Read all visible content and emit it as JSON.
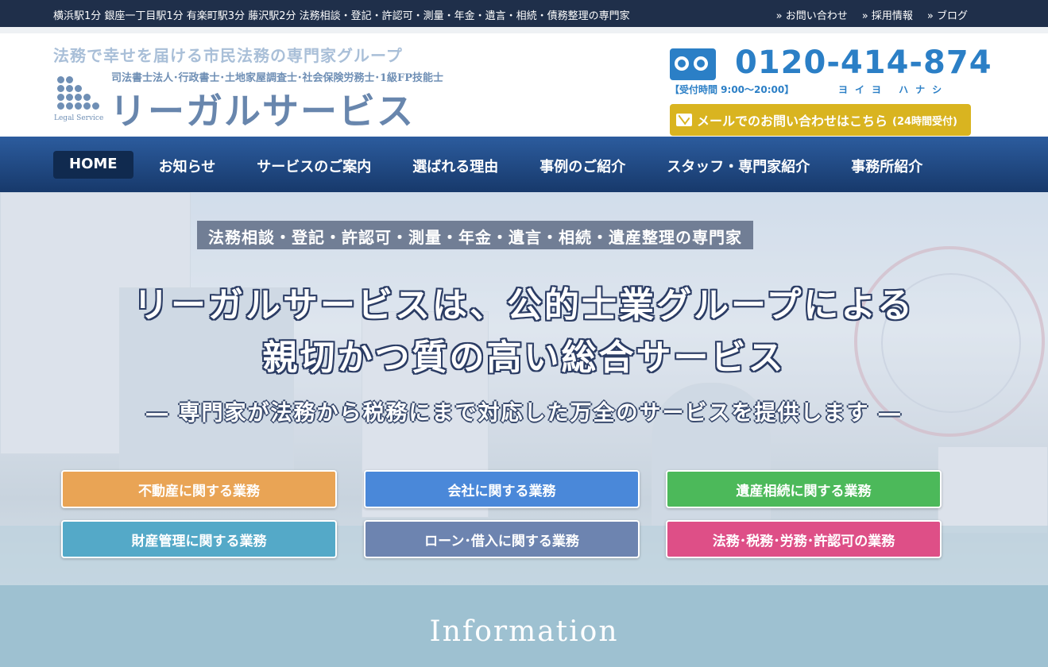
{
  "topbar": {
    "tagline": "横浜駅1分 銀座一丁目駅1分 有楽町駅3分 藤沢駅2分 法務相談・登記・許認可・測量・年金・遺言・相続・債務整理の専門家",
    "links": [
      {
        "label": "お問い合わせ"
      },
      {
        "label": "採用情報"
      },
      {
        "label": "ブログ"
      }
    ]
  },
  "header": {
    "slogan": "法務で幸せを届ける市民法務の専門家グループ",
    "subtitle": "司法書士法人･行政書士･土地家屋調査士･社会保険労務士･1級FP技能士",
    "brand_name": "リーガルサービス",
    "logo_caption": "Legal Service",
    "phone": {
      "number": "0120-414-874",
      "hours": "【受付時間 9:00～20:00】",
      "reading": "ヨイヨ ハナシ"
    },
    "mail_button": {
      "label": "メールでのお問い合わせはこちら",
      "note": "(24時間受付)"
    }
  },
  "nav": {
    "items": [
      {
        "label": "HOME",
        "active": true
      },
      {
        "label": "お知らせ"
      },
      {
        "label": "サービスのご案内"
      },
      {
        "label": "選ばれる理由"
      },
      {
        "label": "事例のご紹介"
      },
      {
        "label": "スタッフ・専門家紹介"
      },
      {
        "label": "事務所紹介"
      }
    ]
  },
  "hero": {
    "badge": "法務相談・登記・許認可・測量・年金・遺言・相続・遺産整理の専門家",
    "title_line1": "リーガルサービスは、公的士業グループによる",
    "title_line2": "親切かつ質の高い総合サービス",
    "lead": "― 専門家が法務から税務にまで対応した万全のサービスを提供します ―",
    "services": [
      {
        "label": "不動産に関する業務",
        "color": "#e9a455"
      },
      {
        "label": "会社に関する業務",
        "color": "#4a88d9"
      },
      {
        "label": "遺産相続に関する業務",
        "color": "#4cb95a"
      },
      {
        "label": "財産管理に関する業務",
        "color": "#54a9c8"
      },
      {
        "label": "ローン･借入に関する業務",
        "color": "#6d84b0"
      },
      {
        "label": "法務･税務･労務･許認可の業務",
        "color": "#de4f87"
      }
    ]
  },
  "info": {
    "title": "Information"
  },
  "colors": {
    "topbar": "#1f2f4a",
    "nav_start": "#2c5c9e",
    "nav_end": "#17396b",
    "phone_blue": "#2b7fc6",
    "mail_gold": "#d9b420",
    "info_band": "#9ec1d1"
  },
  "icons": [
    "double-chevron-right-icon",
    "freedial-icon",
    "mail-envelope-icon",
    "logo-dots-icon"
  ]
}
